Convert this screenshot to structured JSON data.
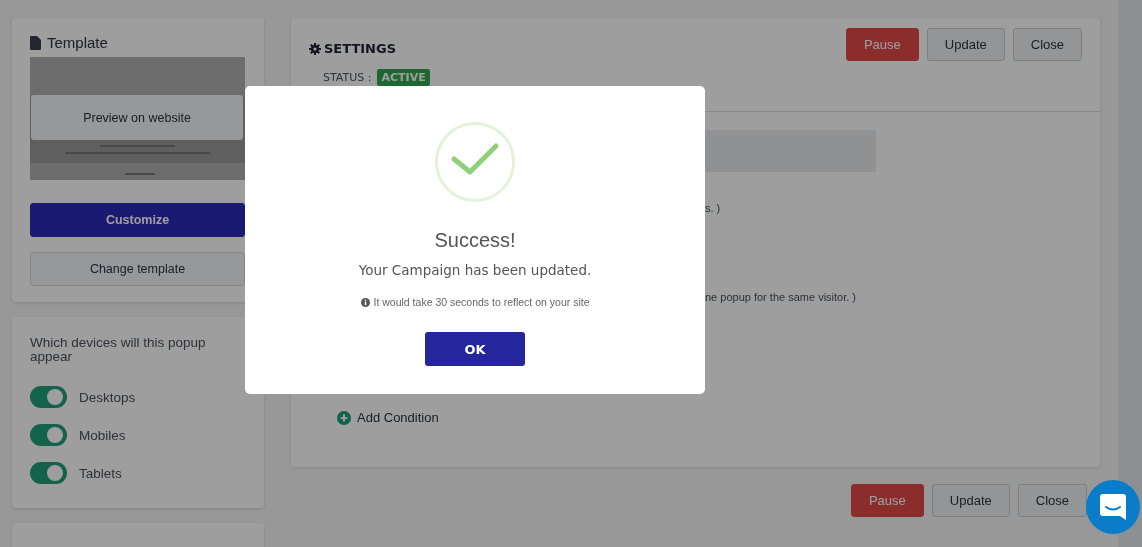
{
  "template_card": {
    "title": "Template",
    "preview_button": "Preview on website",
    "customize_button": "Customize",
    "change_button": "Change template"
  },
  "devices_card": {
    "question": "Which devices will this popup appear",
    "devices": [
      {
        "label": "Desktops",
        "on": true
      },
      {
        "label": "Mobiles",
        "on": true
      },
      {
        "label": "Tablets",
        "on": true
      }
    ]
  },
  "settings": {
    "title": "SETTINGS",
    "status_label": "STATUS :",
    "status_badge": "ACTIVE",
    "buttons": [
      {
        "label": "Pause",
        "kind": "danger"
      },
      {
        "label": "Update",
        "kind": "default"
      },
      {
        "label": "Close",
        "kind": "default"
      }
    ],
    "note_1": "s. )",
    "note_2": "ne popup for the same visitor. )",
    "add_condition": "Add Condition"
  },
  "footer_buttons": [
    {
      "label": "Pause",
      "kind": "danger"
    },
    {
      "label": "Update",
      "kind": "default"
    },
    {
      "label": "Close",
      "kind": "default"
    }
  ],
  "dialog": {
    "title": "Success!",
    "message": "Your Campaign has been updated.",
    "note": "It would take 30 seconds to reflect on your site",
    "ok_button": "OK"
  }
}
